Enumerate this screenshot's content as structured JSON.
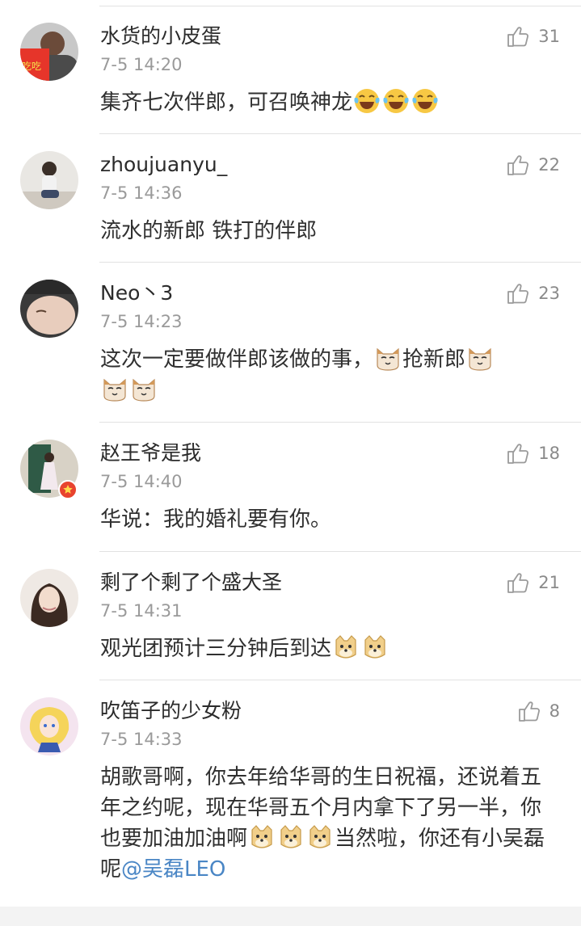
{
  "comments": [
    {
      "username": "水货的小皮蛋",
      "time": "7-5 14:20",
      "likes": "31",
      "text_parts": [
        "集齐七次伴郎，可召唤神龙"
      ],
      "emojis": [
        "laugh-cry-emoji",
        "laugh-cry-emoji",
        "laugh-cry-emoji"
      ]
    },
    {
      "username": "zhoujuanyu_",
      "time": "7-5 14:36",
      "likes": "22",
      "text": "流水的新郎 铁打的伴郎"
    },
    {
      "username": "Neo丶3",
      "time": "7-5 14:23",
      "likes": "23",
      "text_parts": [
        "这次一定要做伴郎该做的事，",
        "抢新郎"
      ],
      "emojis": [
        "cat-emoji",
        "cat-emoji",
        "cat-emoji",
        "cat-emoji"
      ]
    },
    {
      "username": "赵王爷是我",
      "time": "7-5 14:40",
      "likes": "18",
      "text": "华说：我的婚礼要有你。",
      "verified_badge": true
    },
    {
      "username": "剩了个剩了个盛大圣",
      "time": "7-5 14:31",
      "likes": "21",
      "text_parts": [
        "观光团预计三分钟后到达"
      ],
      "emojis": [
        "doge-emoji",
        "doge-emoji"
      ]
    },
    {
      "username": "吹笛子的少女粉",
      "time": "7-5 14:33",
      "likes": "8",
      "text_parts": [
        "胡歌哥啊，你去年给华哥的生日祝福，还说着五年之约呢，现在华哥五个月内拿下了另一半，你也要加油加油啊",
        "当然啦，你还有小吴磊呢",
        "@吴磊LEO"
      ],
      "emojis": [
        "doge-emoji",
        "doge-emoji",
        "doge-emoji"
      ]
    }
  ],
  "colors": {
    "mention": "#4a86c5",
    "divider": "#e2e2e2",
    "meta_text": "#9a9a9a",
    "badge_red": "#e8432e"
  }
}
